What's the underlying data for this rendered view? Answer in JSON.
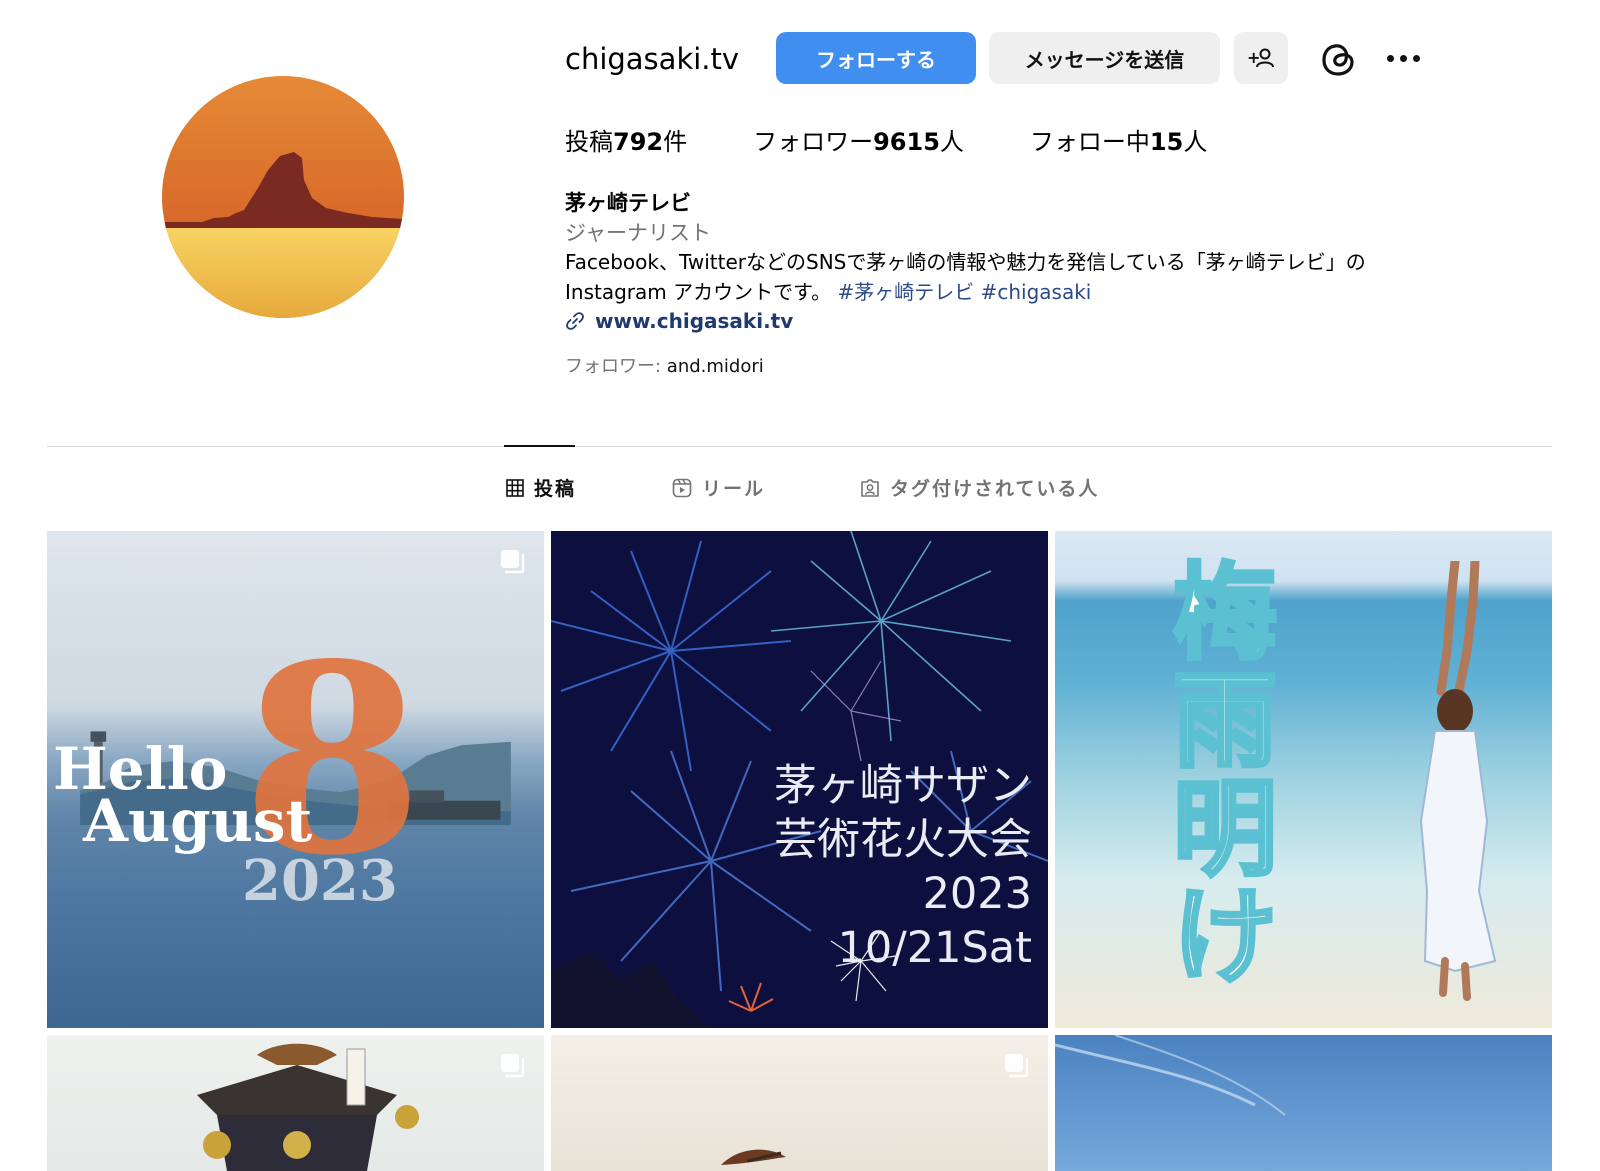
{
  "profile": {
    "username": "chigasaki.tv",
    "follow_label": "フォローする",
    "message_label": "メッセージを送信",
    "add_user_label": "+",
    "stats": {
      "posts_prefix": "投稿",
      "posts_count": "792",
      "posts_suffix": "件",
      "followers_prefix": "フォロワー",
      "followers_count": "9615",
      "followers_suffix": "人",
      "following_prefix": "フォロー中",
      "following_count": "15",
      "following_suffix": "人"
    },
    "full_name": "茅ヶ崎テレビ",
    "category": "ジャーナリスト",
    "bio_line1": "Facebook、TwitterなどのSNSで茅ヶ崎の情報や魅力を発信している「茅ヶ崎テレビ」の",
    "bio_line2": "Instagram アカウントです。 ",
    "hashtag1": "#茅ヶ崎テレビ",
    "hashtag2": "#chigasaki",
    "website": "www.chigasaki.tv",
    "followed_by_label": "フォロワー: ",
    "followed_by_user": "and.midori"
  },
  "tabs": [
    {
      "label": "投稿",
      "icon": "grid-icon",
      "active": true
    },
    {
      "label": "リール",
      "icon": "reels-icon",
      "active": false
    },
    {
      "label": "タグ付けされている人",
      "icon": "tagged-icon",
      "active": false
    }
  ],
  "posts": {
    "post1": {
      "line1": "Hello",
      "line2": "August",
      "big_number": "8",
      "year": "2023"
    },
    "post2": {
      "line1": "茅ヶ崎サザン",
      "line2": "芸術花火大会",
      "line3": "2023",
      "line4": "10/21Sat"
    },
    "post3": {
      "vertical_text": "梅雨明け"
    }
  },
  "colors": {
    "follow_button": "#3f8ef0",
    "link": "#1f3a6e",
    "hashtag": "#2b4a8a",
    "secondary_text": "#737373"
  }
}
